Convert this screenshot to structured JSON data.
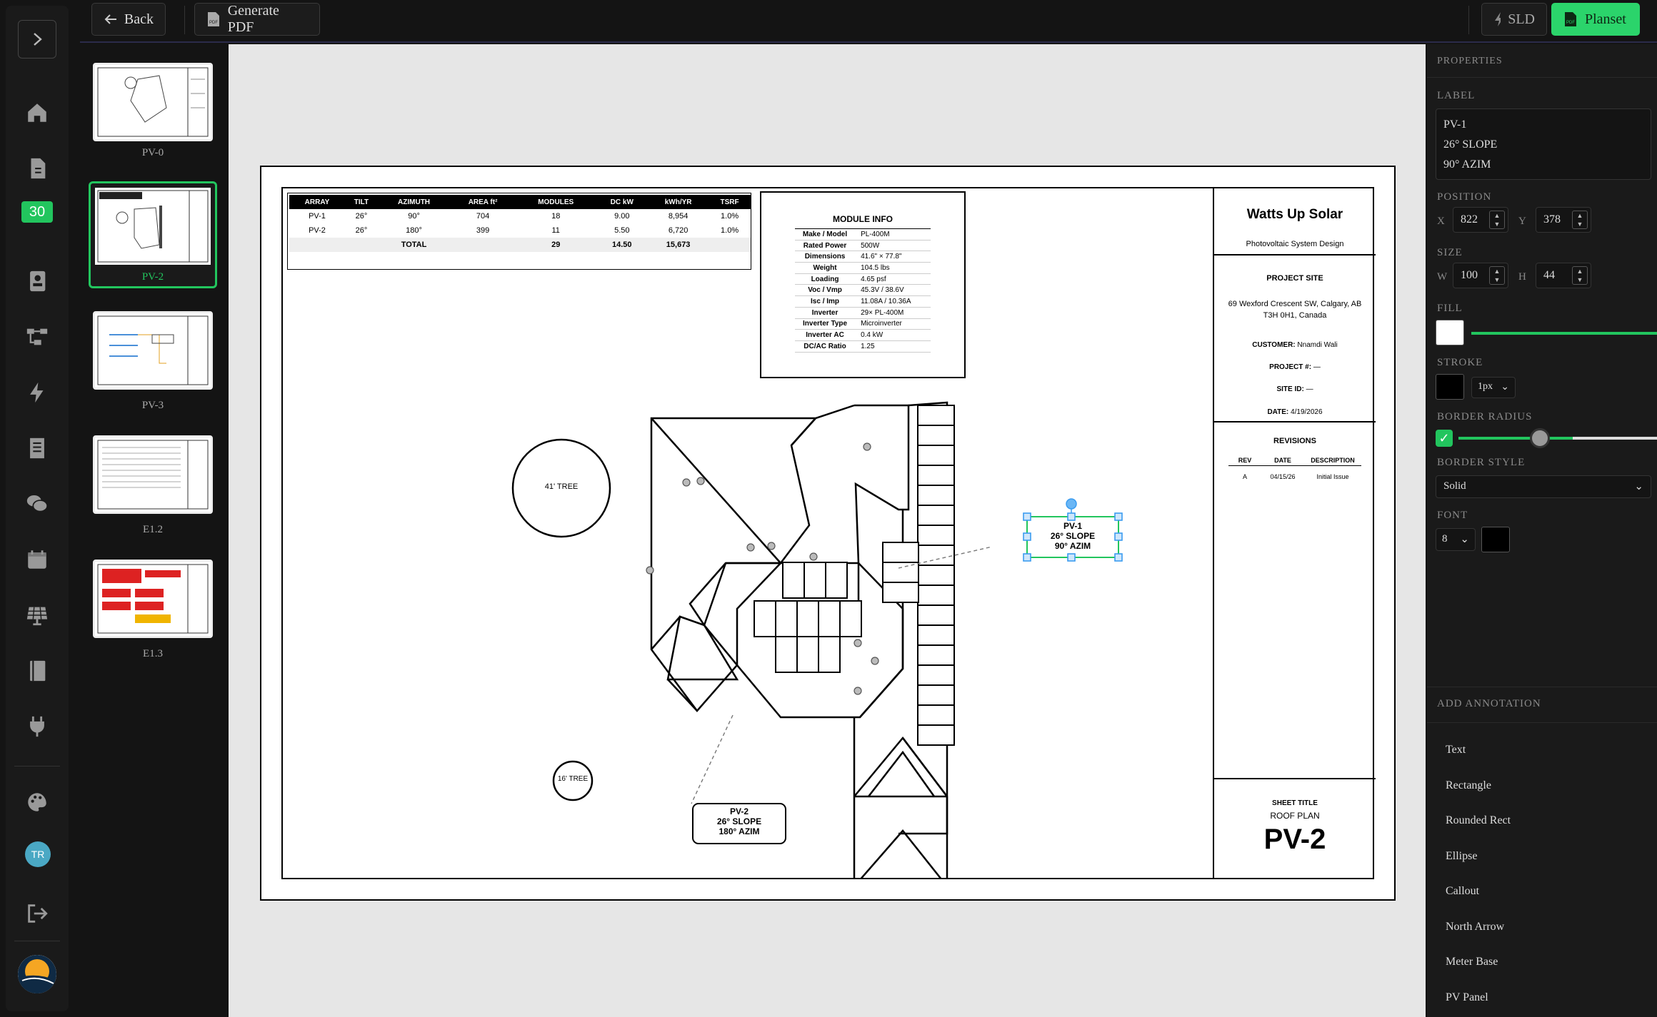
{
  "rail": {
    "badge": "30",
    "avatar": "TR"
  },
  "thumbnails": [
    {
      "label": "PV-0",
      "selected": false
    },
    {
      "label": "PV-2",
      "selected": true
    },
    {
      "label": "PV-3",
      "selected": false
    },
    {
      "label": "E1.2",
      "selected": false
    },
    {
      "label": "E1.3",
      "selected": false
    }
  ],
  "toolbar": {
    "back": "Back",
    "generate": "Generate PDF",
    "sld": "SLD",
    "planset": "Planset"
  },
  "array_table": {
    "headers": [
      "ARRAY",
      "TILT",
      "AZIMUTH",
      "AREA ft²",
      "MODULES",
      "DC kW",
      "kWh/YR",
      "TSRF"
    ],
    "rows": [
      [
        "PV-1",
        "26°",
        "90°",
        "704",
        "18",
        "9.00",
        "8,954",
        "1.0%"
      ],
      [
        "PV-2",
        "26°",
        "180°",
        "399",
        "11",
        "5.50",
        "6,720",
        "1.0%"
      ]
    ],
    "total": {
      "label": "TOTAL",
      "modules": "29",
      "dc": "14.50",
      "kwh": "15,673"
    }
  },
  "module_info": {
    "title": "MODULE INFO",
    "rows": [
      [
        "Make / Model",
        "PL-400M"
      ],
      [
        "Rated Power",
        "500W"
      ],
      [
        "Dimensions",
        "41.6\" × 77.8\""
      ],
      [
        "Weight",
        "104.5 lbs"
      ],
      [
        "Loading",
        "4.65 psf"
      ],
      [
        "Voc / Vmp",
        "45.3V / 38.6V"
      ],
      [
        "Isc / Imp",
        "11.08A / 10.36A"
      ],
      [
        "Inverter",
        "29× PL-400M"
      ],
      [
        "Inverter Type",
        "Microinverter"
      ],
      [
        "Inverter AC",
        "0.4 kW"
      ],
      [
        "DC/AC Ratio",
        "1.25"
      ]
    ]
  },
  "title_block": {
    "company": "Watts Up Solar",
    "subtitle": "Photovoltaic System Design",
    "site_head": "PROJECT SITE",
    "address1": "69 Wexford Crescent SW, Calgary, AB",
    "address2": "T3H 0H1, Canada",
    "customer_label": "CUSTOMER:",
    "customer": "Nnamdi Wali",
    "project_label": "PROJECT #:",
    "project": "—",
    "siteid_label": "SITE ID:",
    "siteid": "—",
    "date_label": "DATE:",
    "date": "4/19/2026",
    "revisions": "REVISIONS",
    "rev_headers": [
      "REV",
      "DATE",
      "DESCRIPTION"
    ],
    "rev_row": [
      "A",
      "04/15/26",
      "Initial Issue"
    ],
    "sheet_title_label": "SHEET TITLE",
    "sheet_title": "ROOF PLAN",
    "sheet_no": "PV-2"
  },
  "drawing": {
    "tree1": "41' TREE",
    "tree2": "16' TREE",
    "pv1": [
      "PV-1",
      "26° SLOPE",
      "90° AZIM"
    ],
    "pv2": [
      "PV-2",
      "26° SLOPE",
      "180° AZIM"
    ]
  },
  "properties": {
    "title": "PROPERTIES",
    "label_head": "LABEL",
    "label_lines": [
      "PV-1",
      "26° SLOPE",
      "90° AZIM"
    ],
    "position_head": "POSITION",
    "x_label": "X",
    "x": "822",
    "y_label": "Y",
    "y": "378",
    "size_head": "SIZE",
    "w_label": "W",
    "w": "100",
    "h_label": "H",
    "h": "44",
    "fill_head": "FILL",
    "fill_color": "#ffffff",
    "stroke_head": "STROKE",
    "stroke_color": "#000000",
    "stroke_width": "1px",
    "radius_head": "BORDER RADIUS",
    "style_head": "BORDER STYLE",
    "style": "Solid",
    "font_head": "FONT",
    "font_size": "8",
    "font_color": "#000000",
    "annot_head": "ADD ANNOTATION",
    "annotations": [
      "Text",
      "Rectangle",
      "Rounded Rect",
      "Ellipse",
      "Callout",
      "North Arrow",
      "Meter Base",
      "PV Panel"
    ]
  },
  "colors": {
    "accent": "#22c55e",
    "handle": "#3b9cf0"
  }
}
